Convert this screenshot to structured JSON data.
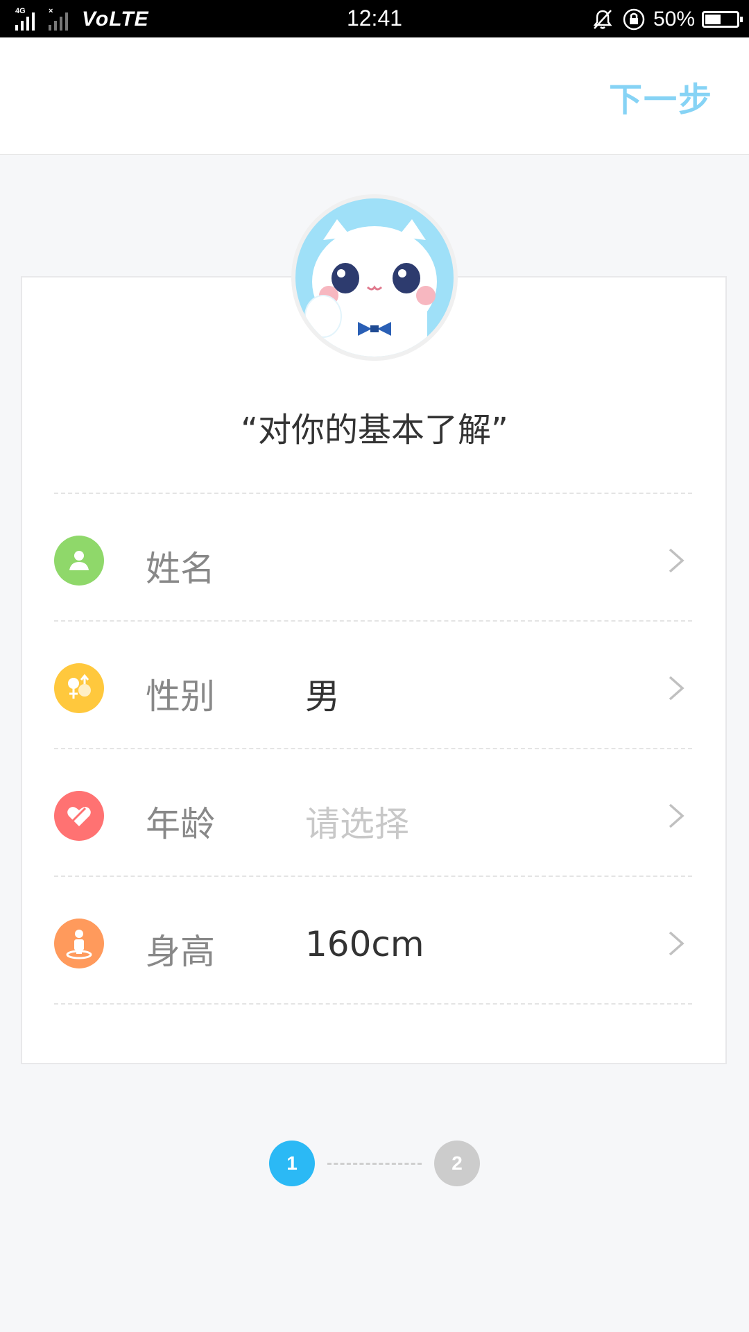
{
  "status_bar": {
    "network_label_1": "4G",
    "network_label_2": "×",
    "volte": "VoLTE",
    "time": "12:41",
    "battery_percent": "50%",
    "battery_level": 0.5
  },
  "header": {
    "next_label": "下一步",
    "next_color": "#86d3f5"
  },
  "card": {
    "title": "“对你的基本了解”",
    "rows": [
      {
        "label": "姓名",
        "value": "",
        "icon": "person-icon",
        "color": "#8fd86a"
      },
      {
        "label": "性别",
        "value": "男",
        "icon": "gender-icon",
        "color": "#ffc83d"
      },
      {
        "label": "年龄",
        "value": "请选择",
        "icon": "heart-icon",
        "color": "#ff7272"
      },
      {
        "label": "身高",
        "value": "160cm",
        "icon": "height-icon",
        "color": "#ff9a5c"
      }
    ]
  },
  "steps": {
    "step1": "1",
    "step2": "2",
    "active_color": "#2bb9f5",
    "inactive_color": "#cccccc"
  }
}
